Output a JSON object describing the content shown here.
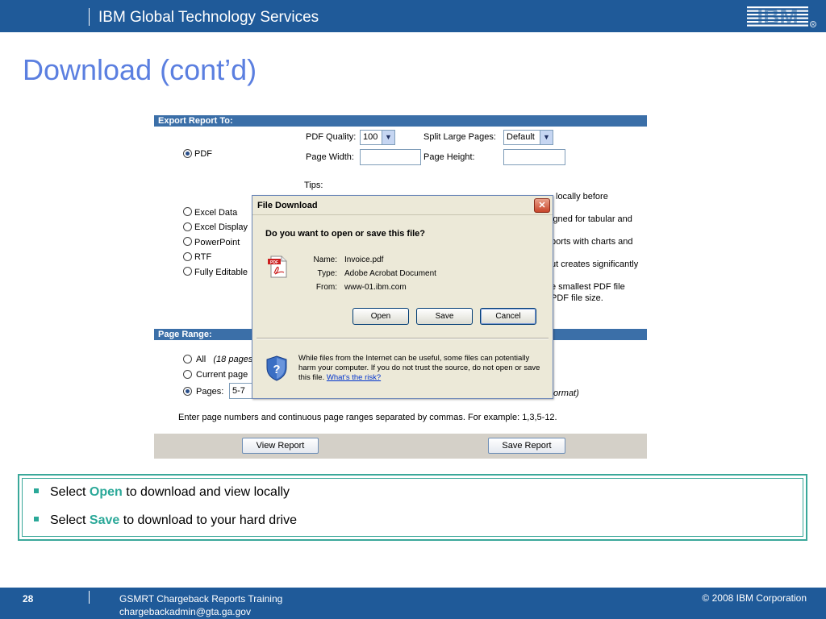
{
  "header": {
    "brand": "IBM Global Technology Services",
    "logo_text": "IBM",
    "title": "Download (cont’d)"
  },
  "report": {
    "export_title": "Export Report To:",
    "pdf_quality_label": "PDF Quality:",
    "pdf_quality_value": "100",
    "split_label": "Split Large Pages:",
    "split_value": "Default",
    "page_width_label": "Page Width:",
    "page_height_label": "Page Height:",
    "formats": [
      "PDF",
      "Excel Data",
      "Excel Display",
      "PowerPoint",
      "RTF",
      "Fully Editable"
    ],
    "selected_format": "PDF",
    "tips_label": "Tips:",
    "tips_fragments": [
      "locally before",
      "igned for tabular and",
      "ports with charts and",
      "ut creates significantly",
      "e smallest PDF file",
      "PDF file size."
    ],
    "page_range_title": "Page Range:",
    "range_all_label": "All",
    "range_all_note": "(18 pages",
    "range_current_label": "Current page",
    "range_pages_label": "Pages:",
    "range_pages_value": "5-7",
    "range_format_fragment": "ormat)",
    "hint": "Enter page numbers and continuous page ranges separated by commas. For example: 1,3,5-12.",
    "view_button": "View Report",
    "save_button": "Save Report"
  },
  "dialog": {
    "title": "File Download",
    "close_glyph": "✕",
    "question": "Do you want to open or save this file?",
    "name_label": "Name:",
    "name_value": "Invoice.pdf",
    "type_label": "Type:",
    "type_value": "Adobe Acrobat Document",
    "from_label": "From:",
    "from_value": "www-01.ibm.com",
    "open_button": "Open",
    "save_button": "Save",
    "cancel_button": "Cancel",
    "warning": "While files from the Internet can be useful, some files can potentially harm your computer. If you do not trust the source, do not open or save this file.",
    "risk_link": "What's the risk?",
    "pdf_icon_text": "PDF"
  },
  "notes": {
    "b1_pre": "Select ",
    "b1_hl": "Open",
    "b1_post": " to download and view locally",
    "b2_pre": "Select ",
    "b2_hl": "Save",
    "b2_post": " to download to your hard drive"
  },
  "footer": {
    "page": "28",
    "course": "GSMRT Chargeback Reports Training",
    "email": "chargebackadmin@gta.ga.gov",
    "copyright": "© 2008 IBM Corporation"
  },
  "colors": {
    "header_blue": "#1f5a99",
    "title_blue": "#5b7fe0",
    "accent_teal": "#2aa898",
    "section_bar": "#3b6fa8"
  }
}
